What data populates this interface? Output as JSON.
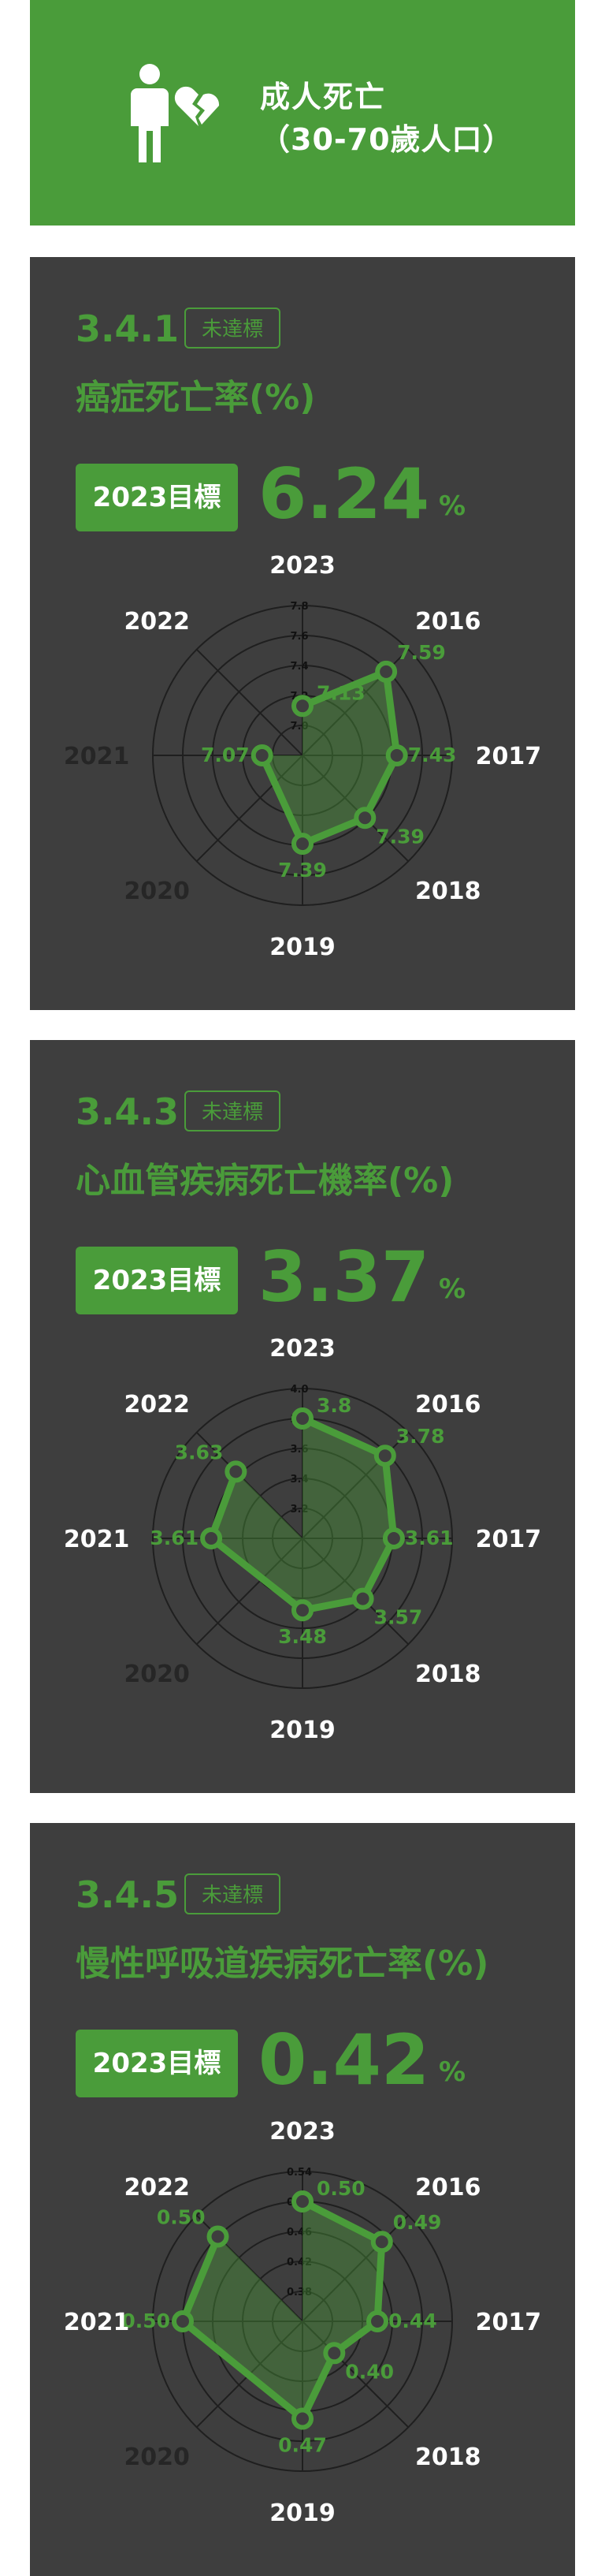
{
  "header": {
    "title_line1": "成人死亡",
    "title_line2": "（30-70歲人口）",
    "icon": "person-broken-heart-icon"
  },
  "colors": {
    "green": "#4a9c3a",
    "card_bg": "#3e3e3e",
    "white": "#ffffff"
  },
  "target_label": "2023目標",
  "unit": "%",
  "indicators": [
    {
      "code": "3.4.1",
      "status": "未達標",
      "name": "癌症死亡率(%)",
      "target": "6.24"
    },
    {
      "code": "3.4.3",
      "status": "未達標",
      "name": "心血管疾病死亡機率(%)",
      "target": "3.37"
    },
    {
      "code": "3.4.5",
      "status": "未達標",
      "name": "慢性呼吸道疾病死亡率(%)",
      "target": "0.42"
    }
  ],
  "chart_data": [
    {
      "type": "radar",
      "axes": [
        "2023",
        "2016",
        "2017",
        "2018",
        "2019",
        "2020",
        "2021",
        "2022"
      ],
      "values": [
        7.13,
        7.59,
        7.43,
        7.39,
        7.39,
        null,
        7.07,
        null
      ],
      "value_labels": [
        "7.13",
        "7.59",
        "7.43",
        "7.39",
        "7.39",
        "",
        "7.07",
        ""
      ],
      "rmin": 6.8,
      "rmax": 7.8,
      "ring_ticks": [
        "7.0",
        "7.2",
        "7.4",
        "7.6",
        "7.8"
      ],
      "dim_axes": [
        "2020",
        "2021"
      ]
    },
    {
      "type": "radar",
      "axes": [
        "2023",
        "2016",
        "2017",
        "2018",
        "2019",
        "2020",
        "2021",
        "2022"
      ],
      "values": [
        3.8,
        3.78,
        3.61,
        3.57,
        3.48,
        null,
        3.61,
        3.63
      ],
      "value_labels": [
        "3.8",
        "3.78",
        "3.61",
        "3.57",
        "3.48",
        "",
        "3.61",
        "3.63"
      ],
      "rmin": 3.0,
      "rmax": 4.0,
      "ring_ticks": [
        "3.2",
        "3.4",
        "3.6",
        "3.8",
        "4.0"
      ],
      "dim_axes": [
        "2020"
      ]
    },
    {
      "type": "radar",
      "axes": [
        "2023",
        "2016",
        "2017",
        "2018",
        "2019",
        "2020",
        "2021",
        "2022"
      ],
      "values": [
        0.5,
        0.49,
        0.44,
        0.4,
        0.47,
        null,
        0.5,
        0.5
      ],
      "value_labels": [
        "0.50",
        "0.49",
        "0.44",
        "0.40",
        "0.47",
        "",
        "0.50",
        "0.50"
      ],
      "rmin": 0.34,
      "rmax": 0.54,
      "ring_ticks": [
        "0.38",
        "0.42",
        "0.46",
        "0.50",
        "0.54"
      ],
      "dim_axes": [
        "2020"
      ]
    }
  ]
}
